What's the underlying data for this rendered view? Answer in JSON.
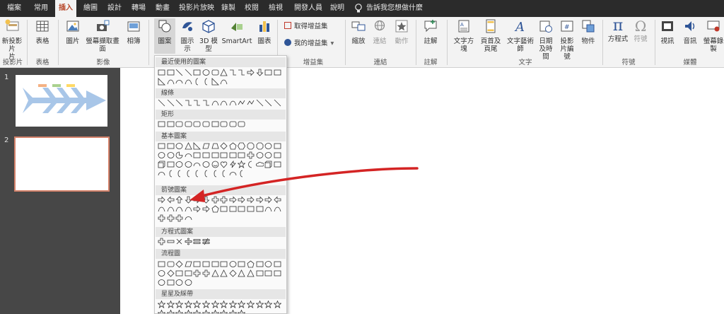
{
  "tabs": [
    {
      "label": "檔案",
      "active": false
    },
    {
      "label": "常用",
      "active": false
    },
    {
      "label": "插入",
      "active": true
    },
    {
      "label": "繪圖",
      "active": false
    },
    {
      "label": "設計",
      "active": false
    },
    {
      "label": "轉場",
      "active": false
    },
    {
      "label": "動畫",
      "active": false
    },
    {
      "label": "投影片放映",
      "active": false
    },
    {
      "label": "錄製",
      "active": false
    },
    {
      "label": "校閱",
      "active": false
    },
    {
      "label": "檢視",
      "active": false
    },
    {
      "label": "開發人員",
      "active": false
    },
    {
      "label": "說明",
      "active": false
    }
  ],
  "tell_me": "告訴我您想做什麼",
  "ribbon": {
    "new_slide": "新投影片",
    "new_slide_2": "片",
    "table": "表格",
    "pictures": "圖片",
    "screenshot": "螢幕擷取畫面",
    "album": "相簿",
    "shapes": "圖案",
    "icons": "圖示",
    "icons_2": "示",
    "model3d": "3D 模",
    "model3d_2": "型",
    "smartart": "SmartArt",
    "chart": "圖表",
    "get_addins": "取得增益集",
    "my_addins": "我的增益集",
    "zoom": "縮放",
    "link": "連結",
    "action": "動作",
    "comment": "註解",
    "textbox": "文字方塊",
    "header_footer": "頁首及頁尾",
    "wordart": "文字藝術師",
    "datetime": "日期及時間",
    "slide_number": "投影片編號",
    "object": "物件",
    "equation": "方程式",
    "symbol": "符號",
    "video": "視訊",
    "audio": "音訊",
    "screen_record": "螢幕錄製",
    "groups": {
      "slides": "投影片",
      "tables": "表格",
      "images": "影像",
      "addins": "增益集",
      "links": "連結",
      "comments": "註解",
      "text": "文字",
      "symbols": "符號",
      "media": "媒體"
    }
  },
  "slides": [
    {
      "number": "1"
    },
    {
      "number": "2"
    }
  ],
  "dropdown": {
    "sections": [
      "最近使用的圖案",
      "線條",
      "矩形",
      "基本圖案",
      "箭號圖案",
      "方程式圖案",
      "流程圖",
      "星星及綵帶"
    ]
  },
  "colors": {
    "tab_bar": "#2b2b2b",
    "ribbon_bg": "#f3f3f3",
    "accent": "#b7472a",
    "slide_pane": "#474747",
    "annotation_arrow": "#d42424"
  }
}
